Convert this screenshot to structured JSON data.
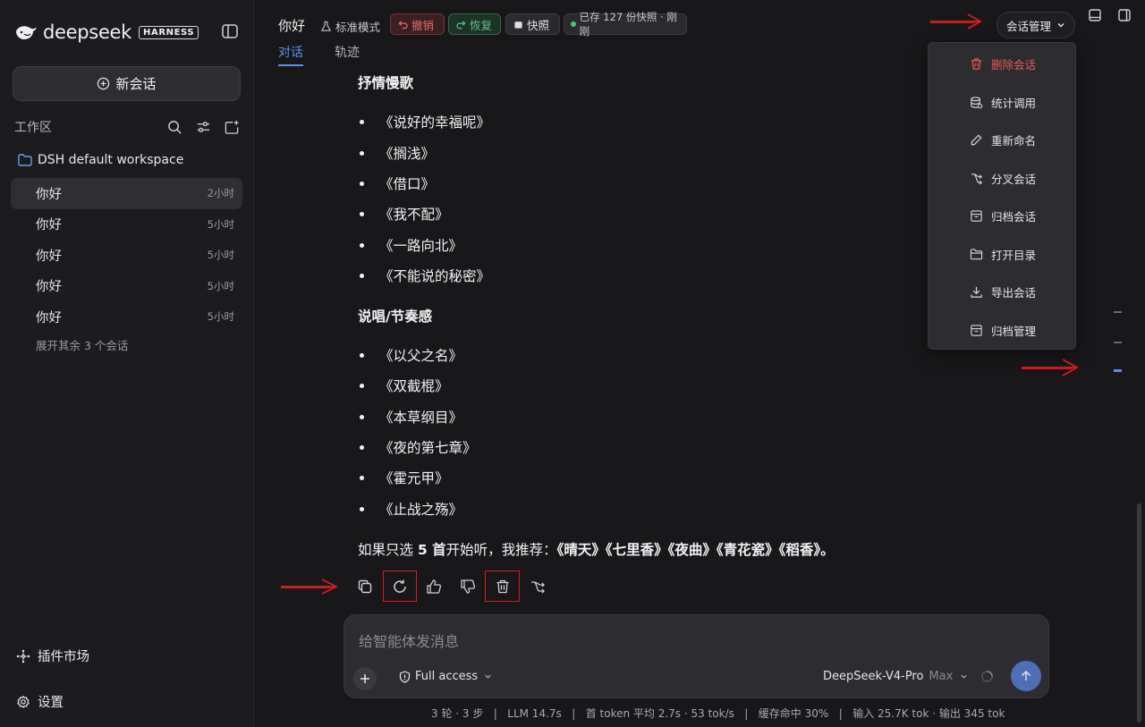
{
  "sidebar": {
    "brand": "deepseek",
    "badge": "HARNESS",
    "new_chat_label": "新会话",
    "workspace_label": "工作区",
    "workspace_name": "DSH default workspace",
    "conversations": [
      {
        "title": "你好",
        "time": "2小时"
      },
      {
        "title": "你好",
        "time": "5小时"
      },
      {
        "title": "你好",
        "time": "5小时"
      },
      {
        "title": "你好",
        "time": "5小时"
      },
      {
        "title": "你好",
        "time": "5小时"
      }
    ],
    "expand_more": "展开其余 3 个会话",
    "plugin_market": "插件市场",
    "settings": "设置"
  },
  "header": {
    "title": "你好",
    "mode": "标准模式",
    "undo": "撤销",
    "redo": "恢复",
    "snapshot": "快照",
    "saved_status": "已存 127 份快照 · 刚刚",
    "tabs": [
      "对话",
      "轨迹"
    ],
    "active_tab": "对话",
    "session_menu_button": "会话管理"
  },
  "session_menu": {
    "items": [
      {
        "label": "删除会话",
        "icon": "trash-icon",
        "danger": true
      },
      {
        "label": "统计调用",
        "icon": "database-icon"
      },
      {
        "label": "重新命名",
        "icon": "pencil-icon"
      },
      {
        "label": "分叉会话",
        "icon": "fork-icon"
      },
      {
        "label": "归档会话",
        "icon": "archive-icon"
      },
      {
        "label": "打开目录",
        "icon": "folder-icon"
      },
      {
        "label": "导出会话",
        "icon": "download-icon"
      },
      {
        "label": "归档管理",
        "icon": "archive-icon"
      }
    ]
  },
  "message": {
    "section1": "抒情慢歌",
    "songs1": [
      "《说好的幸福呢》",
      "《搁浅》",
      "《借口》",
      "《我不配》",
      "《一路向北》",
      "《不能说的秘密》"
    ],
    "section2": "说唱/节奏感",
    "songs2": [
      "《以父之名》",
      "《双截棍》",
      "《本草纲目》",
      "《夜的第七章》",
      "《霍元甲》",
      "《止战之殇》"
    ],
    "rec_prefix": "如果只选 ",
    "rec_count": "5 首",
    "rec_mid": "开始听，我推荐：",
    "rec_list": "《晴天》《七里香》《夜曲》《青花瓷》《稻香》。"
  },
  "message_actions": [
    "copy-icon",
    "regenerate-icon",
    "thumbs-up-icon",
    "thumbs-down-icon",
    "delete-icon",
    "fork-icon"
  ],
  "composer": {
    "placeholder": "给智能体发消息",
    "access": "Full access",
    "model": "DeepSeek-V4-Pro",
    "tier": "Max"
  },
  "status_bar": "3 轮 · 3 步   |   LLM 14.7s   |   首 token 平均 2.7s · 53 tok/s   |   缓存命中 30%   |   输入 25.7K tok · 输出 345 tok",
  "colors": {
    "accent": "#5c8fe8",
    "danger": "#e36a6a",
    "success": "#5bc38a",
    "annotation_red": "#d91c1c"
  }
}
